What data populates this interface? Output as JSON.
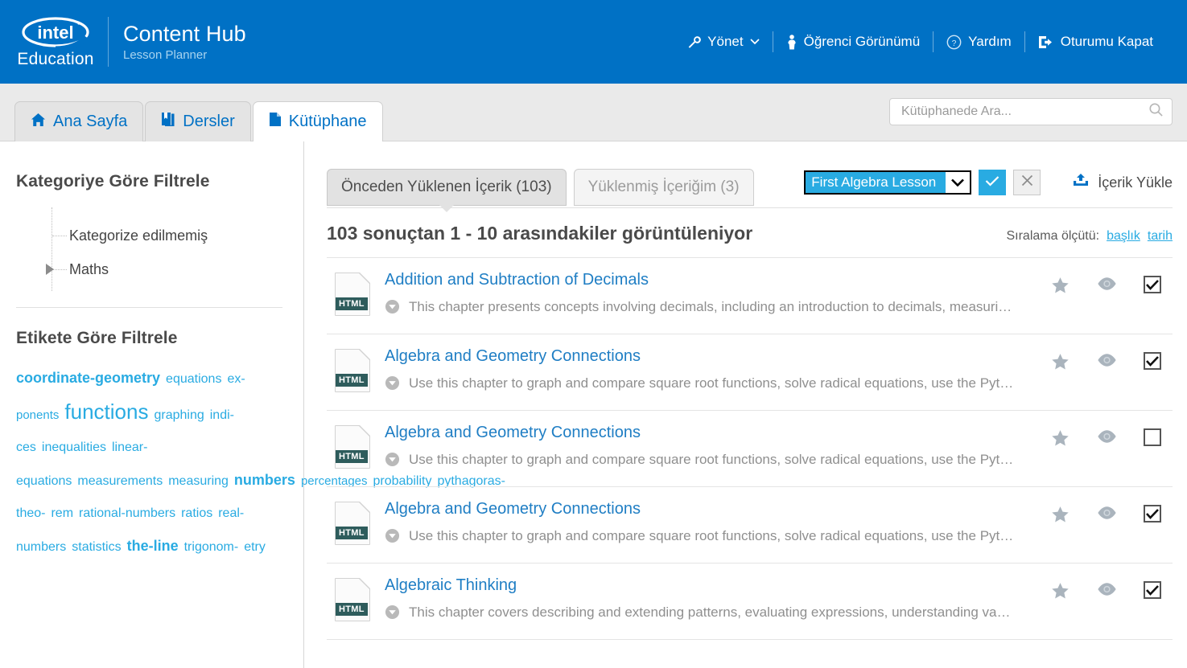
{
  "header": {
    "logo_alt": "intel",
    "logo_sub": "Education",
    "app_title": "Content Hub",
    "app_subtitle": "Lesson Planner",
    "brand_color": "#0071c5",
    "nav": [
      {
        "label": "Yönet",
        "icon": "wrench-icon",
        "has_chevron": true
      },
      {
        "label": "Öğrenci Görünümü",
        "icon": "person-icon",
        "has_chevron": false
      },
      {
        "label": "Yardım",
        "icon": "question-circle-icon",
        "has_chevron": false
      },
      {
        "label": "Oturumu Kapat",
        "icon": "logout-icon",
        "has_chevron": false
      }
    ]
  },
  "tabs": [
    {
      "label": "Ana Sayfa",
      "icon": "home-icon",
      "active": false
    },
    {
      "label": "Dersler",
      "icon": "book-icon",
      "active": false
    },
    {
      "label": "Kütüphane",
      "icon": "document-icon",
      "active": true
    }
  ],
  "search": {
    "placeholder": "Kütüphanede Ara...",
    "value": "",
    "icon": "search-icon"
  },
  "sidebar": {
    "category_heading": "Kategoriye Göre Filtrele",
    "categories": [
      {
        "label": "Kategorize edilmemiş",
        "expandable": false
      },
      {
        "label": "Maths",
        "expandable": true
      }
    ],
    "tag_heading": "Etikete Göre Filtrele",
    "tag_color": "#29abe2",
    "tags": [
      {
        "label": "coordinate-geometry",
        "size": "s3"
      },
      {
        "label": "equations",
        "size": "s2"
      },
      {
        "label": "ex-",
        "size": "s2"
      },
      {
        "label": "ponents",
        "size": "s1"
      },
      {
        "label": "functions",
        "size": "s4"
      },
      {
        "label": "graphing",
        "size": "s2"
      },
      {
        "label": "indi-",
        "size": "s2"
      },
      {
        "label": "ces",
        "size": "s2"
      },
      {
        "label": "inequalities",
        "size": "s2"
      },
      {
        "label": "linear-equations",
        "size": "s2"
      },
      {
        "label": "measurements",
        "size": "s2"
      },
      {
        "label": "measuring",
        "size": "s2"
      },
      {
        "label": "numbers",
        "size": "s3"
      },
      {
        "label": "percentages",
        "size": "s1"
      },
      {
        "label": "probability",
        "size": "s2"
      },
      {
        "label": "pythagoras-theo-",
        "size": "s2"
      },
      {
        "label": "rem",
        "size": "s2"
      },
      {
        "label": "rational-numbers",
        "size": "s2"
      },
      {
        "label": "ratios",
        "size": "s2"
      },
      {
        "label": "real-",
        "size": "s2"
      },
      {
        "label": "numbers",
        "size": "s2"
      },
      {
        "label": "statistics",
        "size": "s2"
      },
      {
        "label": "the-line",
        "size": "s3"
      },
      {
        "label": "trigonom-",
        "size": "s2"
      },
      {
        "label": "etry",
        "size": "s2"
      }
    ]
  },
  "content": {
    "tabs": [
      {
        "label": "Önceden Yüklenen İçerik (103)",
        "active": true
      },
      {
        "label": "Yüklenmiş İçeriğim (3)",
        "active": false
      }
    ],
    "lesson_select": {
      "value": "First Algebra Lesson",
      "options": [
        "First Algebra Lesson"
      ],
      "highlight_color": "#29abe2"
    },
    "confirm_label": "✓",
    "cancel_label": "✕",
    "upload_label": "İçerik Yükle",
    "results_summary": "103 sonuçtan 1 - 10 arasındakiler görüntüleniyor",
    "sort_label": "Sıralama ölçütü:",
    "sort_options": [
      {
        "label": "başlık"
      },
      {
        "label": "tarih"
      }
    ],
    "rows": [
      {
        "filetype": "HTML",
        "title": "Addition and Subtraction of Decimals",
        "description": "This chapter presents concepts involving decimals, including an introduction to decimals, measuri…",
        "starred": false,
        "checked": true
      },
      {
        "filetype": "HTML",
        "title": "Algebra and Geometry Connections",
        "description": "Use this chapter to graph and compare square root functions, solve radical equations, use the Pyt…",
        "starred": false,
        "checked": true
      },
      {
        "filetype": "HTML",
        "title": "Algebra and Geometry Connections",
        "description": "Use this chapter to graph and compare square root functions, solve radical equations, use the Pyt…",
        "starred": false,
        "checked": false
      },
      {
        "filetype": "HTML",
        "title": "Algebra and Geometry Connections",
        "description": "Use this chapter to graph and compare square root functions, solve radical equations, use the Pyt…",
        "starred": false,
        "checked": true
      },
      {
        "filetype": "HTML",
        "title": "Algebraic Thinking",
        "description": "This chapter covers describing and extending patterns, evaluating expressions, understanding va…",
        "starred": false,
        "checked": true
      }
    ]
  }
}
